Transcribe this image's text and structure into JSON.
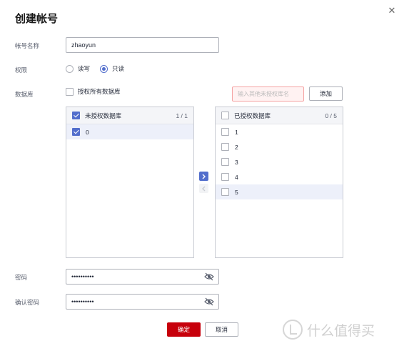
{
  "dialog": {
    "title": "创建帐号"
  },
  "form": {
    "account_label": "帐号名称",
    "account_value": "zhaoyun",
    "permission_label": "权限",
    "permission_options": [
      "读写",
      "只读"
    ],
    "permission_selected": "只读",
    "database_label": "数据库",
    "authorize_all_label": "授权所有数据库",
    "other_db_placeholder": "输入其他未授权库名",
    "add_button": "添加",
    "password_label": "密码",
    "password_value": "••••••••••",
    "confirm_password_label": "确认密码",
    "confirm_password_value": "••••••••••"
  },
  "unauthorized": {
    "title": "未授权数据库",
    "count": "1 / 1",
    "items": [
      {
        "label": "0",
        "checked": true
      }
    ]
  },
  "authorized": {
    "title": "已授权数据库",
    "count": "0 / 5",
    "items": [
      {
        "label": "1",
        "checked": false
      },
      {
        "label": "2",
        "checked": false
      },
      {
        "label": "3",
        "checked": false
      },
      {
        "label": "4",
        "checked": false
      },
      {
        "label": "5",
        "checked": false
      }
    ]
  },
  "footer": {
    "confirm": "确定",
    "cancel": "取消"
  },
  "watermark": {
    "text": "什么值得买"
  },
  "icons": [
    "close-icon",
    "chevron-right-icon",
    "chevron-left-icon",
    "eye-off-icon",
    "watermark-logo-icon"
  ],
  "colors": {
    "primary": "#c7000b",
    "accent": "#526ecc"
  }
}
